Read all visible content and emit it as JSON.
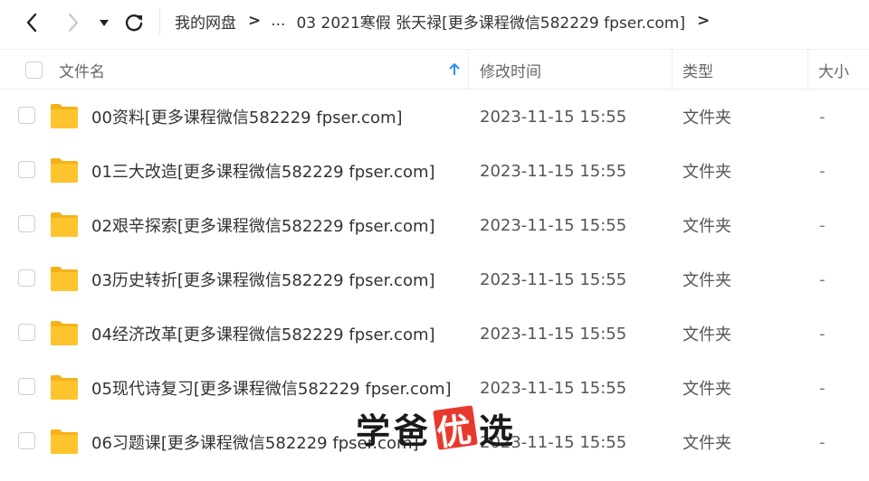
{
  "breadcrumb": {
    "root": "我的网盘",
    "ellipsis": "...",
    "current": "03 2021寒假 张天禄[更多课程微信582229 fpser.com]"
  },
  "columns": {
    "name": "文件名",
    "modified": "修改时间",
    "type": "类型",
    "size": "大小"
  },
  "rows": [
    {
      "name": "00资料[更多课程微信582229 fpser.com]",
      "modified": "2023-11-15 15:55",
      "type": "文件夹",
      "size": "-"
    },
    {
      "name": "01三大改造[更多课程微信582229 fpser.com]",
      "modified": "2023-11-15 15:55",
      "type": "文件夹",
      "size": "-"
    },
    {
      "name": "02艰辛探索[更多课程微信582229 fpser.com]",
      "modified": "2023-11-15 15:55",
      "type": "文件夹",
      "size": "-"
    },
    {
      "name": "03历史转折[更多课程微信582229 fpser.com]",
      "modified": "2023-11-15 15:55",
      "type": "文件夹",
      "size": "-"
    },
    {
      "name": "04经济改革[更多课程微信582229 fpser.com]",
      "modified": "2023-11-15 15:55",
      "type": "文件夹",
      "size": "-"
    },
    {
      "name": "05现代诗复习[更多课程微信582229 fpser.com]",
      "modified": "2023-11-15 15:55",
      "type": "文件夹",
      "size": "-"
    },
    {
      "name": "06习题课[更多课程微信582229 fpser.com]",
      "modified": "2023-11-15 15:55",
      "type": "文件夹",
      "size": "-"
    }
  ],
  "watermark": {
    "part1": "学爸",
    "part2": "优",
    "part3": "选"
  },
  "colors": {
    "accent": "#2a8cf0",
    "folder": "#fdc42d",
    "watermark_red": "#e8392c"
  },
  "icons": {
    "back": "chevron-left-icon",
    "forward": "chevron-right-icon",
    "dropdown": "caret-down-icon",
    "refresh": "refresh-icon",
    "sort": "arrow-up-icon",
    "folder": "folder-icon"
  }
}
